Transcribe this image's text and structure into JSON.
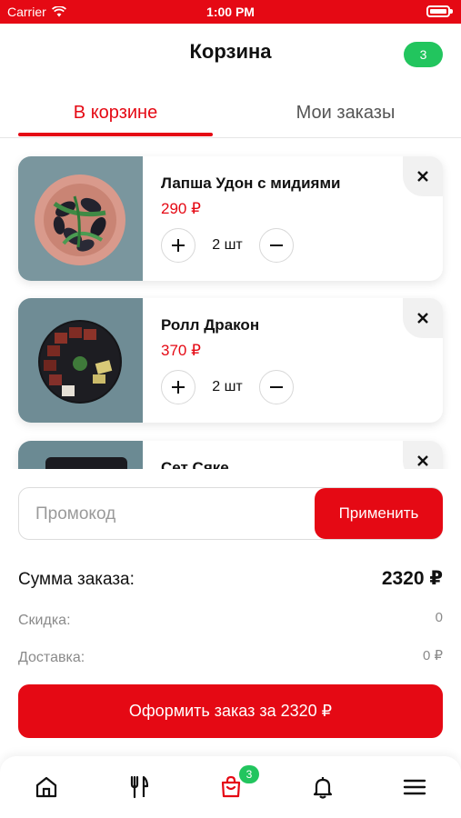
{
  "status_bar": {
    "carrier": "Carrier",
    "time": "1:00 PM"
  },
  "header": {
    "title": "Корзина",
    "cart_count": "3"
  },
  "tabs": [
    {
      "label": "В корзине",
      "active": true
    },
    {
      "label": "Мои заказы",
      "active": false
    }
  ],
  "cart_items": [
    {
      "name": "Лапша Удон с мидиями",
      "price": "290 ₽",
      "quantity": "2 шт",
      "image": "udon-mussels-photo"
    },
    {
      "name": "Ролл Дракон",
      "price": "370 ₽",
      "quantity": "2 шт",
      "image": "dragon-roll-photo"
    },
    {
      "name": "Сет Сяке",
      "image": "sake-set-photo"
    }
  ],
  "promo": {
    "placeholder": "Промокод",
    "value": "",
    "apply_label": "Применить"
  },
  "summary": {
    "total_label": "Сумма заказа:",
    "total_value": "2320 ₽",
    "discount_label": "Скидка:",
    "discount_value": "0",
    "delivery_label": "Доставка:",
    "delivery_value": "0 ₽"
  },
  "checkout_label": "Оформить заказ за 2320 ₽",
  "bottom_nav": {
    "items": [
      "home-icon",
      "menu-fork-knife-icon",
      "cart-bag-icon",
      "bell-icon",
      "hamburger-icon"
    ],
    "active": "cart-bag-icon",
    "cart_badge": "3"
  },
  "colors": {
    "accent": "#e50914",
    "badge_green": "#22c55e",
    "muted_text": "#8a8a8a"
  }
}
